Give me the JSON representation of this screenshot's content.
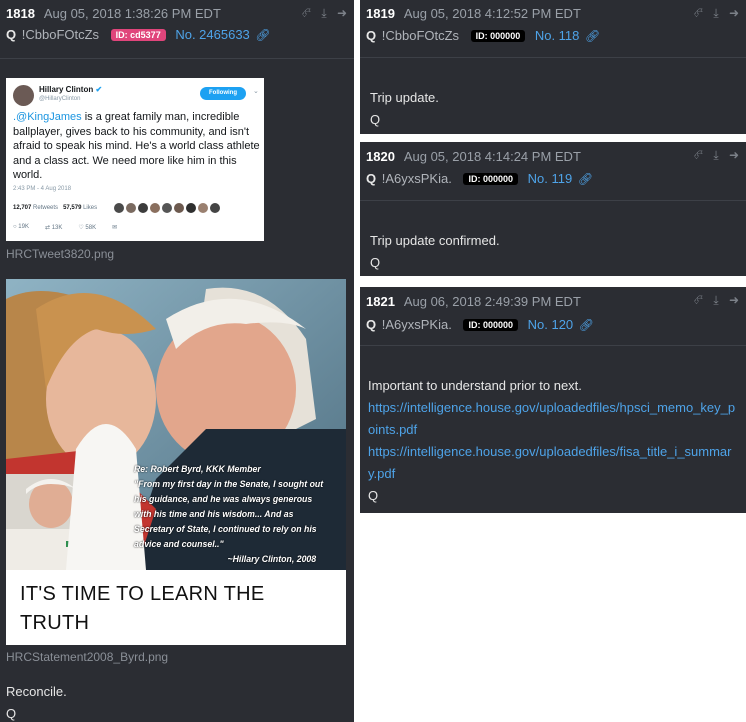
{
  "posts": [
    {
      "number": "1818",
      "date": "Aug 05, 2018 1:38:26 PM EDT",
      "trip": "Q",
      "tripcode": "!CbboFOtcZs",
      "id": "ID: cd5377",
      "post_no": "No. 2465633",
      "tweet": {
        "name": "Hillary Clinton",
        "handle": "@HillaryClinton",
        "follow_label": "Following",
        "mention": ".@KingJames",
        "text": " is a great family man, incredible ballplayer, gives back to his community, and isn't afraid to speak his mind. He's a world class athlete and a class act. We need more like him in this world.",
        "time": "2:43 PM - 4 Aug 2018",
        "retweets": "12,707",
        "retweets_label": "Retweets",
        "likes": "57,579",
        "likes_label": "Likes",
        "replies": "19K",
        "rt_count": "13K",
        "like_count": "58K"
      },
      "file1": "HRCTweet3820.png",
      "photo": {
        "quote_title": "Re: Robert Byrd, KKK Member",
        "quote_body": "\"From my first day in the Senate, I sought out his guidance, and he was always generous with his time and his wisdom... And as Secretary of State, I continued to rely on his advice and counsel..\"",
        "quote_attr": "~Hillary Clinton, 2008",
        "caption": "IT'S TIME TO LEARN THE TRUTH"
      },
      "file2": "HRCStatement2008_Byrd.png",
      "message": "Reconcile.",
      "signature": "Q"
    },
    {
      "number": "1819",
      "date": "Aug 05, 2018 4:12:52 PM EDT",
      "trip": "Q",
      "tripcode": "!CbboFOtcZs",
      "id": "ID: 000000",
      "post_no": "No. 118",
      "message": "Trip update.",
      "signature": "Q"
    },
    {
      "number": "1820",
      "date": "Aug 05, 2018 4:14:24 PM EDT",
      "trip": "Q",
      "tripcode": "!A6yxsPKia.",
      "id": "ID: 000000",
      "post_no": "No. 119",
      "message": "Trip update confirmed.",
      "signature": "Q"
    },
    {
      "number": "1821",
      "date": "Aug 06, 2018 2:49:39 PM EDT",
      "trip": "Q",
      "tripcode": "!A6yxsPKia.",
      "id": "ID: 000000",
      "post_no": "No. 120",
      "message": "Important to understand prior to next.",
      "links": [
        "https://intelligence.house.gov/uploadedfiles/hpsci_memo_key_points.pdf",
        "https://intelligence.house.gov/uploadedfiles/fisa_title_i_summary.pdf"
      ],
      "signature": "Q"
    }
  ],
  "icons": [
    "share-icon",
    "download-icon",
    "arrow-icon",
    "link-icon"
  ],
  "colors": {
    "panel": "#2b2d33",
    "link": "#4ea3e8",
    "id_pink": "#e0457b",
    "twitter_blue": "#1da1f2"
  }
}
